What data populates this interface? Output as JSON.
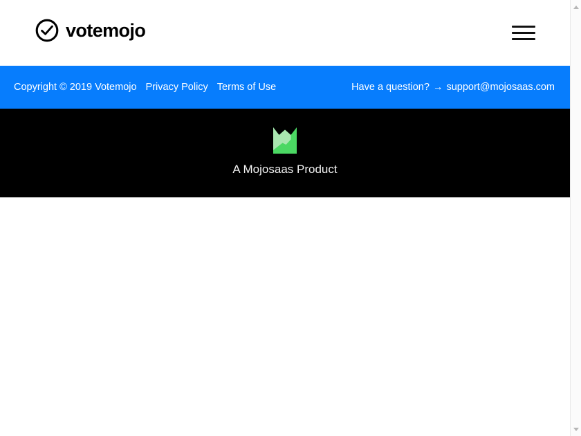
{
  "header": {
    "brand_name": "votemojo",
    "brand_icon": "check-circle-icon",
    "menu_icon": "hamburger-menu-icon"
  },
  "legal_bar": {
    "background_color": "#077dfd",
    "copyright": "Copyright © 2019 Votemojo",
    "links": [
      {
        "label": "Privacy Policy"
      },
      {
        "label": "Terms of Use"
      }
    ],
    "support_prompt": "Have a question?",
    "arrow": "→",
    "support_email": "support@mojosaas.com"
  },
  "product_footer": {
    "background_color": "#000000",
    "logo_icon": "mojosaas-m-logo-icon",
    "logo_color_light": "#a9e7b0",
    "logo_color_dark": "#4bd863",
    "label": "A Mojosaas Product"
  },
  "scrollbar": {
    "up_icon": "scroll-up-arrow-icon",
    "down_icon": "scroll-down-arrow-icon"
  }
}
